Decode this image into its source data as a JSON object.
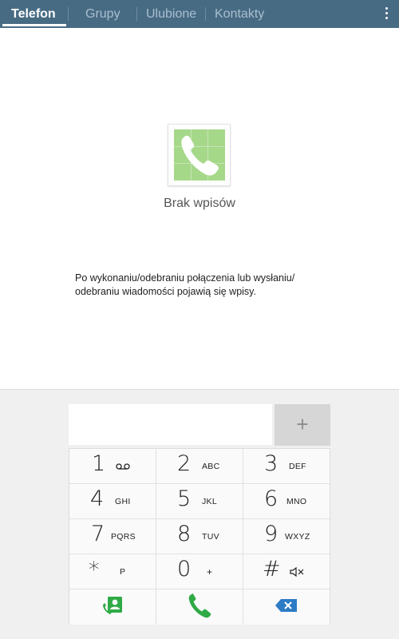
{
  "tabs": [
    {
      "label": "Telefon",
      "active": true
    },
    {
      "label": "Grupy",
      "active": false
    },
    {
      "label": "Ulubione",
      "active": false
    },
    {
      "label": "Kontakty",
      "active": false
    }
  ],
  "empty_state": {
    "icon": "phone-icon",
    "title": "Brak wpisów",
    "description": "Po wykonaniu/odebraniu połączenia lub wysłaniu/ odebraniu wiadomości pojawią się wpisy."
  },
  "dialer": {
    "add_label": "+",
    "keys": [
      {
        "digit": "1",
        "letters": "",
        "icon": "voicemail-icon"
      },
      {
        "digit": "2",
        "letters": "ABC"
      },
      {
        "digit": "3",
        "letters": "DEF"
      },
      {
        "digit": "4",
        "letters": "GHI"
      },
      {
        "digit": "5",
        "letters": "JKL"
      },
      {
        "digit": "6",
        "letters": "MNO"
      },
      {
        "digit": "7",
        "letters": "PQRS"
      },
      {
        "digit": "8",
        "letters": "TUV"
      },
      {
        "digit": "9",
        "letters": "WXYZ"
      },
      {
        "digit": "*",
        "letters": "P"
      },
      {
        "digit": "0",
        "letters": "+"
      },
      {
        "digit": "#",
        "letters": "",
        "icon": "mute-icon"
      }
    ],
    "actions": [
      "contacts-icon",
      "call-icon",
      "backspace-icon"
    ]
  },
  "colors": {
    "tab_bar": "#486b84",
    "call_green": "#2faa46",
    "backspace_blue": "#2d7bc5",
    "icon_tile_green": "#a6d88a"
  }
}
